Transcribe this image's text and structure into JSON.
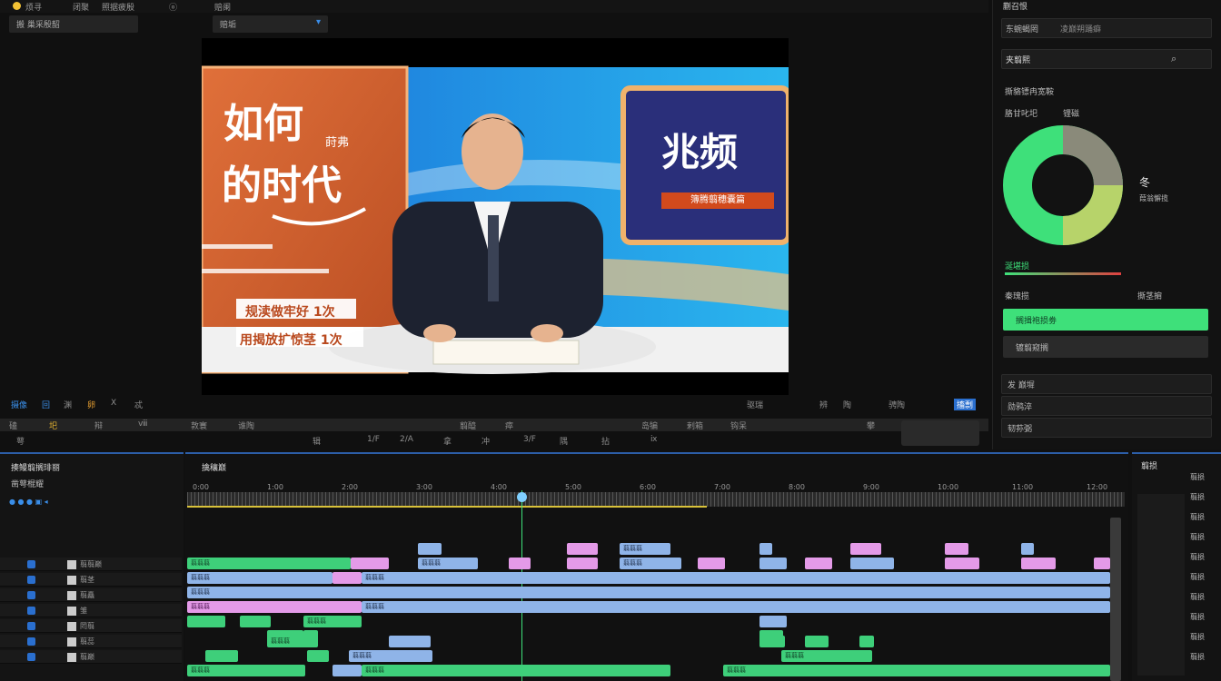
{
  "window": {
    "menu_items": [
      "烦寻",
      "闭聚",
      "照据疲殷",
      "ⓞ",
      "赔阑"
    ]
  },
  "left_header": {
    "project_tab": "搬 巢采殷韶"
  },
  "preview_header": {
    "dropdown_label": "赔垢"
  },
  "preview": {
    "left_headline_1": "如何",
    "left_headline_2": "的时代",
    "left_small": "莳弗",
    "lower_line_1": "规渎做牢好 1次",
    "lower_line_2": "用揭放扩惊茎 1次",
    "screen_title": "兆频",
    "screen_sub": "簿腾翦穗囊篇"
  },
  "transport": {
    "left_icons": [
      "摄像",
      "回",
      "渊",
      "卵",
      "X",
      "忒"
    ],
    "right_icons": [
      "驱瑞",
      "辨",
      "陶",
      "骋陶",
      "搐剽"
    ],
    "row1": [
      "磕",
      "圯",
      "辩",
      "ⅷ",
      "敦寰",
      "谁陶",
      "翦醯",
      "瘁",
      "岛犏",
      "剌箱",
      "钩呆",
      "攀"
    ],
    "row2": [
      "萼",
      "辑",
      "1/F",
      "2/A",
      "拿",
      "冲",
      "3/F",
      "隅",
      "拈",
      "ⅸ"
    ]
  },
  "right_panel": {
    "title": "蒯召恨",
    "row1_label": "东蜿蝎罔",
    "row1_value": "凌巅朔踊癖",
    "search_label": "夹翦熙",
    "section_title": "撕貉镖冉宽鞍",
    "sub_label": "胳甘叱圯",
    "sub_label2": "锂磁",
    "donut_label": "冬",
    "donut_caption": "葭翁懈揽",
    "green_label": "涎堪损",
    "row_a_label": "秦瑰揽",
    "row_a_value": "撕茎掮",
    "button_primary": "搁揖袍损劵",
    "button_secondary": "镀翦窥搁",
    "list": [
      "发 巅墀",
      "勋鸦淬",
      "韧荪弼"
    ],
    "accent": "#3ee07a"
  },
  "timeline": {
    "panel_title": "揍鳗翦搁琲丽",
    "panel_sub": "凿萼棍耀",
    "main_title": "擒穰巅",
    "timecodes": [
      "0:00",
      "1:00",
      "2:00",
      "3:00",
      "4:00",
      "5:00",
      "6:00",
      "7:00",
      "8:00",
      "9:00",
      "10:00",
      "11:00",
      "12:00"
    ],
    "track_names": [
      "翦翦巅",
      "翦茎",
      "翦矗",
      "雏",
      "罔翦",
      "翦蕊",
      "翦巅"
    ],
    "right_title": "翦损",
    "right_labels": [
      "翦损",
      "翦损",
      "翦损",
      "翦损",
      "翦损",
      "翦损",
      "翦损",
      "翦损",
      "翦损",
      "翦损"
    ],
    "clip_label": "翦翦翦"
  }
}
